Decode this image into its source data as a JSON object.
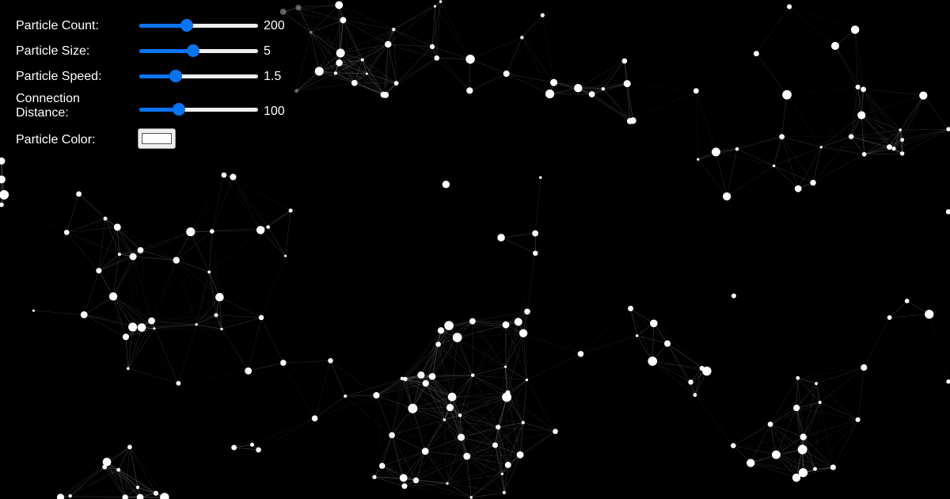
{
  "controls": {
    "count": {
      "label": "Particle Count:",
      "value": "200",
      "min": 10,
      "max": 500,
      "current": 200
    },
    "size": {
      "label": "Particle Size:",
      "value": "5",
      "min": 1,
      "max": 10,
      "current": 5
    },
    "speed": {
      "label": "Particle Speed:",
      "value": "1.5",
      "min": 0.1,
      "max": 5,
      "current": 1.5
    },
    "distance": {
      "label": "Connection Distance:",
      "value": "100",
      "min": 10,
      "max": 300,
      "current": 100
    },
    "color": {
      "label": "Particle Color:",
      "current": "#ffffff"
    }
  },
  "colors": {
    "background": "#000000",
    "particle": "#ffffff",
    "link": "#ffffff",
    "slider_accent": "#0a74f0",
    "slider_track": "#efefef"
  }
}
